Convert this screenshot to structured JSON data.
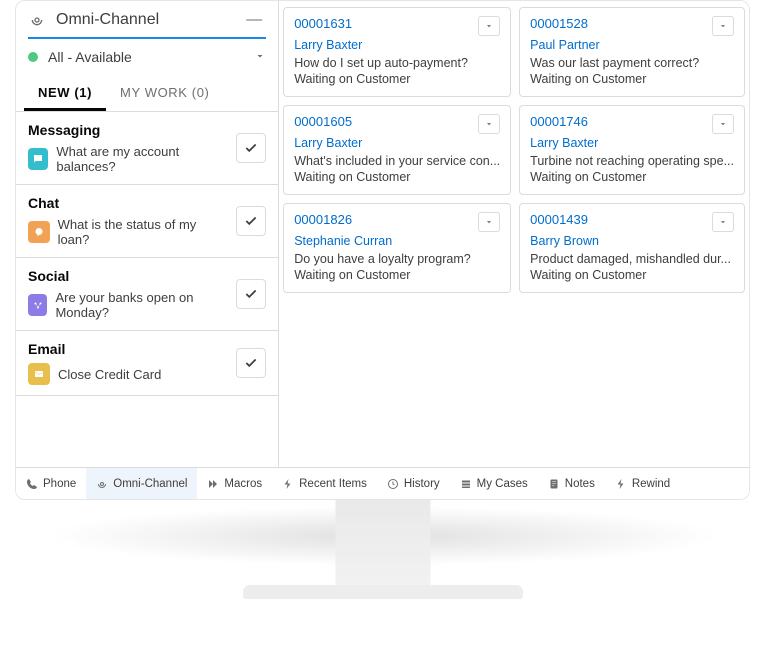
{
  "omni": {
    "title": "Omni-Channel",
    "status_label": "All - Available",
    "tabs": {
      "new": "NEW (1)",
      "mywork": "MY WORK (0)"
    }
  },
  "workitems": [
    {
      "channel": "Messaging",
      "icon": "messaging",
      "message": "What are my account balances?"
    },
    {
      "channel": "Chat",
      "icon": "chat",
      "message": "What is the status of my loan?"
    },
    {
      "channel": "Social",
      "icon": "social",
      "message": "Are your banks open on Monday?"
    },
    {
      "channel": "Email",
      "icon": "email",
      "message": "Close Credit Card"
    }
  ],
  "cases": [
    {
      "number": "00001631",
      "contact": "Larry Baxter",
      "subject": "How do I set up auto-payment?",
      "status": "Waiting on Customer"
    },
    {
      "number": "00001528",
      "contact": "Paul Partner",
      "subject": "Was our last payment correct?",
      "status": "Waiting on Customer"
    },
    {
      "number": "00001605",
      "contact": "Larry Baxter",
      "subject": "What's included in your service con...",
      "status": "Waiting on Customer"
    },
    {
      "number": "00001746",
      "contact": "Larry Baxter",
      "subject": "Turbine not reaching operating spe...",
      "status": "Waiting on Customer"
    },
    {
      "number": "00001826",
      "contact": "Stephanie Curran",
      "subject": "Do you have a loyalty program?",
      "status": "Waiting on Customer"
    },
    {
      "number": "00001439",
      "contact": "Barry Brown",
      "subject": "Product damaged, mishandled dur...",
      "status": "Waiting on Customer"
    }
  ],
  "utility": [
    {
      "label": "Phone",
      "icon": "phone"
    },
    {
      "label": "Omni-Channel",
      "icon": "omni"
    },
    {
      "label": "Macros",
      "icon": "macros"
    },
    {
      "label": "Recent Items",
      "icon": "recent"
    },
    {
      "label": "History",
      "icon": "history"
    },
    {
      "label": "My Cases",
      "icon": "cases"
    },
    {
      "label": "Notes",
      "icon": "notes"
    },
    {
      "label": "Rewind",
      "icon": "rewind"
    }
  ]
}
